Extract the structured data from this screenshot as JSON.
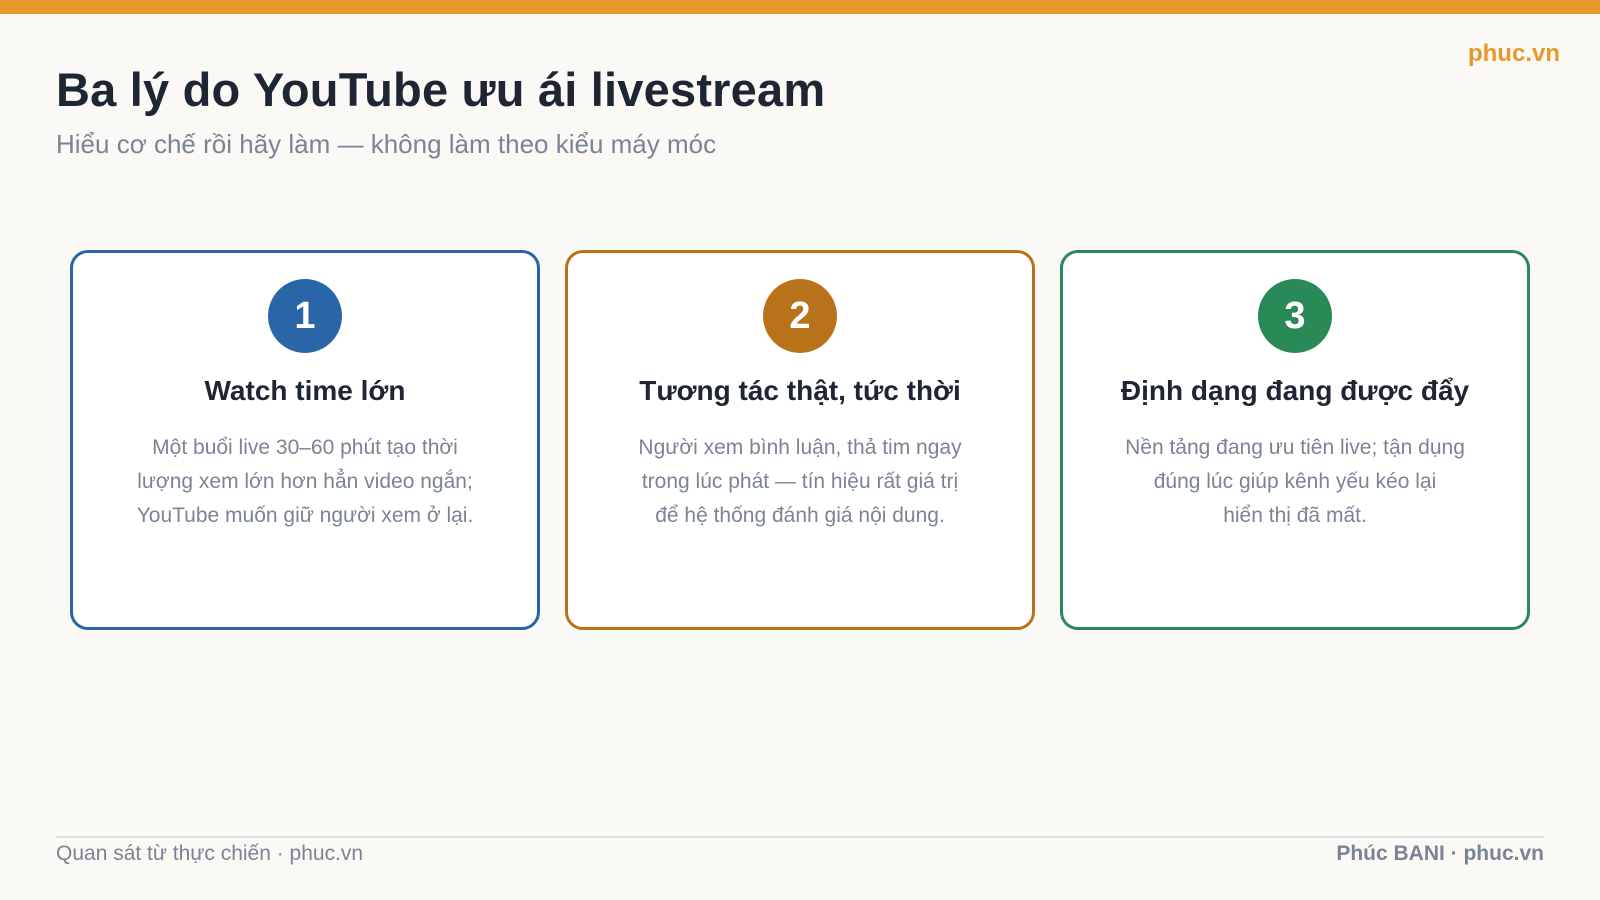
{
  "brand": "phuc.vn",
  "title": "Ba lý do YouTube ưu ái livestream",
  "subtitle": "Hiểu cơ chế rồi hãy làm — không làm theo kiểu máy móc",
  "colors": {
    "accent": "#e8982b",
    "card1": "#2a65a8",
    "card2": "#b8731a",
    "card3": "#2a8a57"
  },
  "cards": [
    {
      "number": "1",
      "title": "Watch time lớn",
      "desc": "Một buổi live 30–60 phút tạo thời\nlượng xem lớn hơn hẳn video ngắn;\nYouTube muốn giữ người xem ở lại."
    },
    {
      "number": "2",
      "title": "Tương tác thật, tức thời",
      "desc": "Người xem bình luận, thả tim ngay\ntrong lúc phát — tín hiệu rất giá trị\nđể hệ thống đánh giá nội dung."
    },
    {
      "number": "3",
      "title": "Định dạng đang được đẩy",
      "desc": "Nền tảng đang ưu tiên live; tận dụng\nđúng lúc giúp kênh yếu kéo lại\nhiển thị đã mất."
    }
  ],
  "footer": {
    "left": "Quan sát từ thực chiến · phuc.vn",
    "right": "Phúc BANI · phuc.vn"
  }
}
